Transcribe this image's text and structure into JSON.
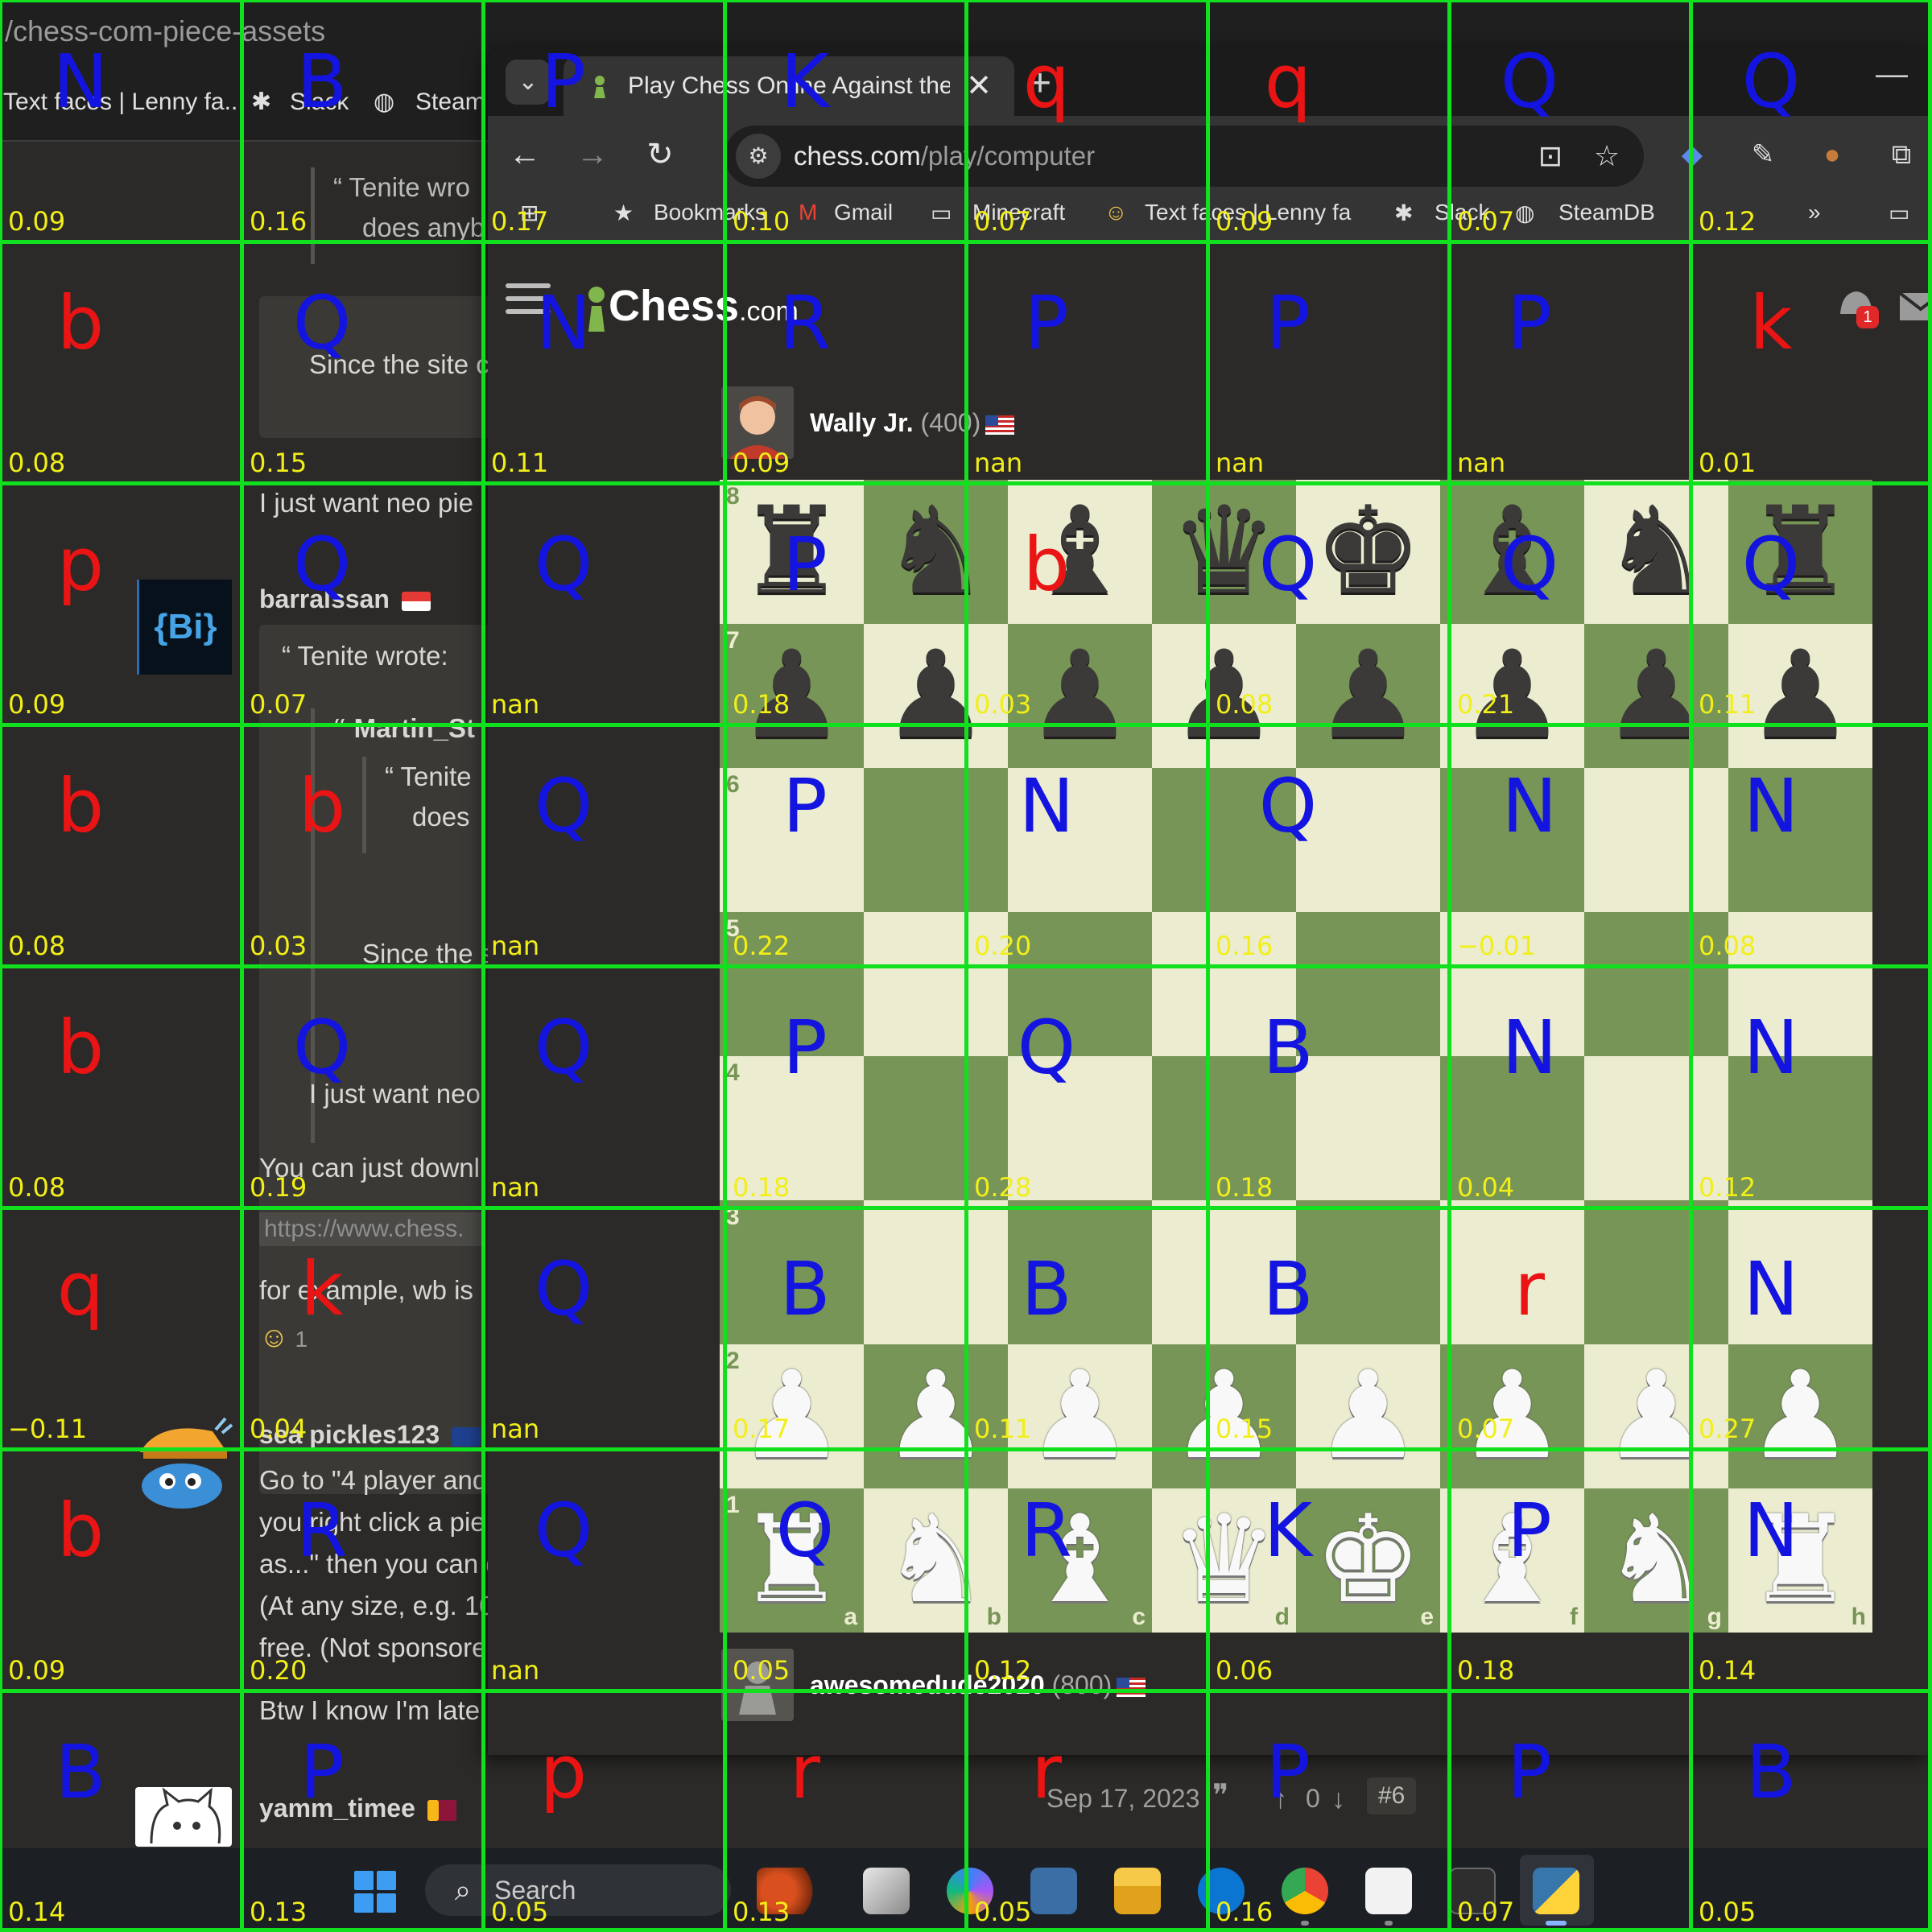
{
  "back_window": {
    "url_fragment": "/chess-com-piece-assets",
    "bookmarks": [
      "Text faces | Lenny fa...",
      "Slack",
      "Steam"
    ],
    "forum": {
      "quote1_author_line": "“ Tenite wro",
      "quote1_text": "does anyb",
      "quote1_reply": "Since the site c",
      "post1_text": "I just want neo pie",
      "author2": "barralssan",
      "quote2_head": "“ Tenite wrote:",
      "quote2_nested1": "“ Martin_St",
      "quote2_nested2": "“ Tenite",
      "quote2_nested3": "does",
      "quote2_nested4": "Since the s",
      "quote2_reply": "I just want neo",
      "post2_text1": "You can just downl",
      "post2_link": "https://www.chess.",
      "post2_text2": "for example, wb is",
      "post2_reaction": "1",
      "author3": "sea pickles123",
      "post3_lines": [
        "Go to \"4 player and",
        "you right click a pie",
        "as...\" then you can d",
        "(At any size, e.g. 10",
        "free. (Not sponsore"
      ],
      "post4_text": "Btw I know I'm late",
      "author4": "yamm_timee",
      "avatar_bi": "{Bi}",
      "post_date": "Sep 17, 2023",
      "vote_count": "0",
      "post_number": "#6"
    }
  },
  "front_window": {
    "tab_title": "Play Chess Online Against the C",
    "url_host": "chess.com",
    "url_path": "/play/computer",
    "bookmarks": [
      "Bookmarks",
      "Gmail",
      "Minecraft",
      "Text faces | Lenny fa",
      "Slack",
      "SteamDB"
    ],
    "logo_text": "Chess",
    "logo_domain": ".com",
    "badge_count": "1",
    "opponent": {
      "name": "Wally Jr.",
      "rating": "(400)"
    },
    "player": {
      "name": "awesomedude2020",
      "rating": "(800)"
    },
    "board": {
      "ranks": [
        "8",
        "7",
        "6",
        "5",
        "4",
        "3",
        "2",
        "1"
      ],
      "files": [
        "a",
        "b",
        "c",
        "d",
        "e",
        "f",
        "g",
        "h"
      ],
      "position": [
        [
          "r",
          "n",
          "b",
          "q",
          "k",
          "b",
          "n",
          "r"
        ],
        [
          "p",
          "p",
          "p",
          "p",
          "p",
          "p",
          "p",
          "p"
        ],
        [
          "",
          "",
          "",
          "",
          "",
          "",
          "",
          ""
        ],
        [
          "",
          "",
          "",
          "",
          "",
          "",
          "",
          ""
        ],
        [
          "",
          "",
          "",
          "",
          "",
          "",
          "",
          ""
        ],
        [
          "",
          "",
          "",
          "",
          "",
          "",
          "",
          ""
        ],
        [
          "P",
          "P",
          "P",
          "P",
          "P",
          "P",
          "P",
          "P"
        ],
        [
          "R",
          "N",
          "B",
          "Q",
          "K",
          "B",
          "N",
          "R"
        ]
      ]
    }
  },
  "taskbar": {
    "search_placeholder": "Search"
  },
  "overlay": {
    "grid_color": "#11e01e",
    "upper_color": "#1414e0",
    "lower_color": "#ea1414",
    "score_color": "#f2ef18",
    "cells": [
      [
        {
          "p": "N",
          "s": "0.09"
        },
        {
          "p": "B",
          "s": "0.16"
        },
        {
          "p": "P",
          "s": "0.17"
        },
        {
          "p": "K",
          "s": "0.10"
        },
        {
          "p": "q",
          "s": "0.07"
        },
        {
          "p": "q",
          "s": "0.09"
        },
        {
          "p": "Q",
          "s": "0.07"
        },
        {
          "p": "Q",
          "s": "0.12"
        }
      ],
      [
        {
          "p": "b",
          "s": "0.08"
        },
        {
          "p": "Q",
          "s": "0.15"
        },
        {
          "p": "N",
          "s": "0.11"
        },
        {
          "p": "R",
          "s": "0.09"
        },
        {
          "p": "P",
          "s": "nan"
        },
        {
          "p": "P",
          "s": "nan"
        },
        {
          "p": "P",
          "s": "nan"
        },
        {
          "p": "k",
          "s": "0.01"
        }
      ],
      [
        {
          "p": "p",
          "s": "0.09"
        },
        {
          "p": "Q",
          "s": "0.07"
        },
        {
          "p": "Q",
          "s": "nan"
        },
        {
          "p": "P",
          "s": "0.18"
        },
        {
          "p": "b",
          "s": "0.03"
        },
        {
          "p": "Q",
          "s": "0.08"
        },
        {
          "p": "Q",
          "s": "0.21"
        },
        {
          "p": "Q",
          "s": "0.11"
        }
      ],
      [
        {
          "p": "b",
          "s": "0.08"
        },
        {
          "p": "b",
          "s": "0.03"
        },
        {
          "p": "Q",
          "s": "nan"
        },
        {
          "p": "P",
          "s": "0.22"
        },
        {
          "p": "N",
          "s": "0.20"
        },
        {
          "p": "Q",
          "s": "0.16"
        },
        {
          "p": "N",
          "s": "−0.01"
        },
        {
          "p": "N",
          "s": "0.08"
        }
      ],
      [
        {
          "p": "b",
          "s": "0.08"
        },
        {
          "p": "Q",
          "s": "0.19"
        },
        {
          "p": "Q",
          "s": "nan"
        },
        {
          "p": "P",
          "s": "0.18"
        },
        {
          "p": "Q",
          "s": "0.28"
        },
        {
          "p": "B",
          "s": "0.18"
        },
        {
          "p": "N",
          "s": "0.04"
        },
        {
          "p": "N",
          "s": "0.12"
        }
      ],
      [
        {
          "p": "q",
          "s": "−0.11"
        },
        {
          "p": "k",
          "s": "0.04"
        },
        {
          "p": "Q",
          "s": "nan"
        },
        {
          "p": "B",
          "s": "0.17"
        },
        {
          "p": "B",
          "s": "0.11"
        },
        {
          "p": "B",
          "s": "0.15"
        },
        {
          "p": "r",
          "s": "0.07"
        },
        {
          "p": "N",
          "s": "0.27"
        }
      ],
      [
        {
          "p": "b",
          "s": "0.09"
        },
        {
          "p": "R",
          "s": "0.20"
        },
        {
          "p": "Q",
          "s": "nan"
        },
        {
          "p": "Q",
          "s": "0.05"
        },
        {
          "p": "R",
          "s": "0.12"
        },
        {
          "p": "K",
          "s": "0.06"
        },
        {
          "p": "P",
          "s": "0.18"
        },
        {
          "p": "N",
          "s": "0.14"
        }
      ],
      [
        {
          "p": "B",
          "s": "0.14"
        },
        {
          "p": "P",
          "s": "0.13"
        },
        {
          "p": "p",
          "s": "0.05"
        },
        {
          "p": "r",
          "s": "0.13"
        },
        {
          "p": "r",
          "s": "0.05"
        },
        {
          "p": "P",
          "s": "0.16"
        },
        {
          "p": "P",
          "s": "0.07"
        },
        {
          "p": "B",
          "s": "0.05"
        }
      ]
    ]
  }
}
